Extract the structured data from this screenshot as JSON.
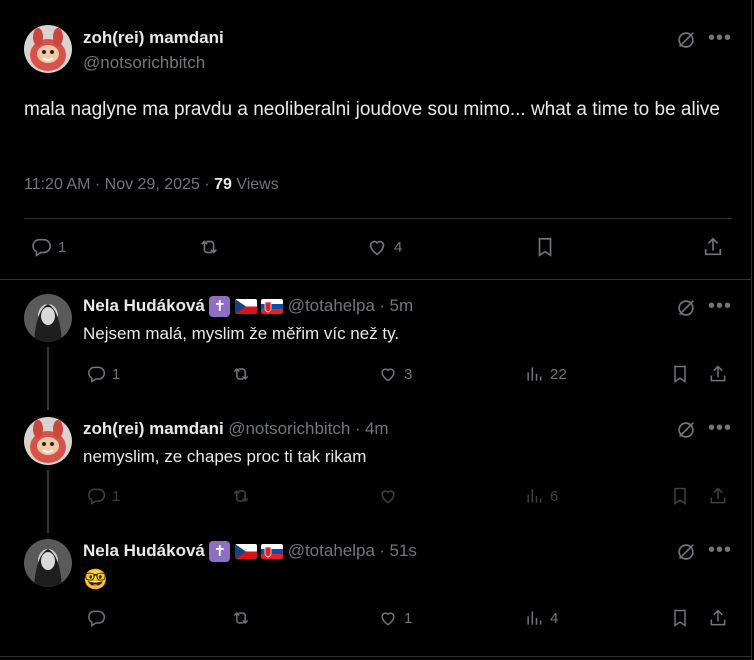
{
  "main_post": {
    "author_name": "zoh(rei) mamdani",
    "author_handle": "@notsorichbitch",
    "text": "mala naglyne ma pravdu a neoliberalni joudove sou mimo... what a time to be alive",
    "time": "11:20 AM",
    "date": "Nov 29, 2025",
    "views_count": "79",
    "views_label": "Views",
    "replies": "1",
    "likes": "4"
  },
  "replies": [
    {
      "author_name": "Nela Hudáková",
      "author_handle": "@totahelpa",
      "time_ago": "5m",
      "text": "Nejsem malá, myslim že měřim víc než ty.",
      "reply_count": "1",
      "like_count": "3",
      "view_count": "22",
      "badge_symbol": "✝"
    },
    {
      "author_name": "zoh(rei) mamdani",
      "author_handle": "@notsorichbitch",
      "time_ago": "4m",
      "text": "nemyslim, ze chapes proc ti tak rikam",
      "reply_count": "1",
      "like_count": "",
      "view_count": "6"
    },
    {
      "author_name": "Nela Hudáková",
      "author_handle": "@totahelpa",
      "time_ago": "51s",
      "text": "🤓",
      "reply_count": "",
      "like_count": "1",
      "view_count": "4",
      "badge_symbol": "✝"
    }
  ],
  "separator": "·",
  "colors": {
    "background": "#000000",
    "text": "#e7e9ea",
    "secondary": "#71767b",
    "border": "#2f3336",
    "badge": "#8e6fc6"
  },
  "icons": {
    "grok": "grok-icon",
    "more": "more-icon",
    "reply": "reply-icon",
    "retweet": "retweet-icon",
    "like": "like-icon",
    "views": "views-icon",
    "bookmark": "bookmark-icon",
    "share": "share-icon"
  }
}
